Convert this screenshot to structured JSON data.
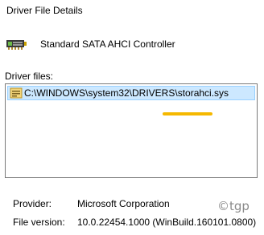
{
  "dialog": {
    "title": "Driver File Details"
  },
  "device": {
    "name": "Standard SATA AHCI Controller",
    "icon": "storage-controller-icon"
  },
  "files": {
    "label": "Driver files:",
    "items": [
      {
        "path": "C:\\WINDOWS\\system32\\DRIVERS\\storahci.sys",
        "icon": "driver-file-icon",
        "selected": true
      }
    ]
  },
  "details": {
    "provider_label": "Provider:",
    "provider_value": "Microsoft Corporation",
    "version_label": "File version:",
    "version_value": "10.0.22454.1000 (WinBuild.160101.0800)"
  },
  "watermark": {
    "text": "©tgp"
  },
  "colors": {
    "selection_bg": "#cce8ff",
    "selection_border": "#99d1ff",
    "highlight_mark": "#f5b800"
  }
}
